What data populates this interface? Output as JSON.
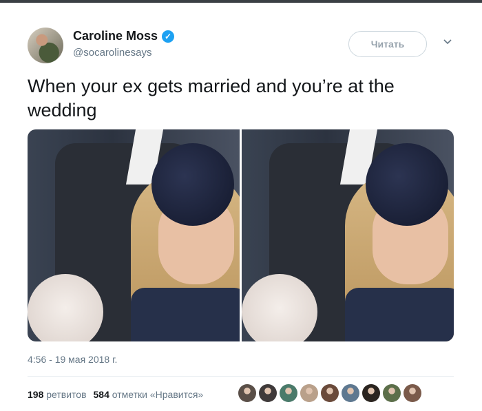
{
  "header": {
    "name": "Caroline Moss",
    "handle": "@socarolinesays",
    "follow_label": "Читать",
    "verified_icon": "verified-badge-icon",
    "chevron_icon": "chevron-down-icon"
  },
  "tweet": {
    "text": "When your ex gets married and you’re at the wedding",
    "timestamp": "4:56 - 19 мая 2018 г."
  },
  "stats": {
    "retweets_count": "198",
    "retweets_label": "ретвитов",
    "likes_count": "584",
    "likes_label": "отметки «Нравится»"
  },
  "likers": [
    {
      "color": "#5a4f48"
    },
    {
      "color": "#3f3a3a"
    },
    {
      "color": "#4a7a6a"
    },
    {
      "color": "#b9a08a"
    },
    {
      "color": "#6a4a3a"
    },
    {
      "color": "#5e7890"
    },
    {
      "color": "#2a241f"
    },
    {
      "color": "#5c6f4a"
    },
    {
      "color": "#7a5a4a"
    }
  ],
  "colors": {
    "accent": "#1da1f2",
    "text_primary": "#14171a",
    "text_secondary": "#657786"
  }
}
